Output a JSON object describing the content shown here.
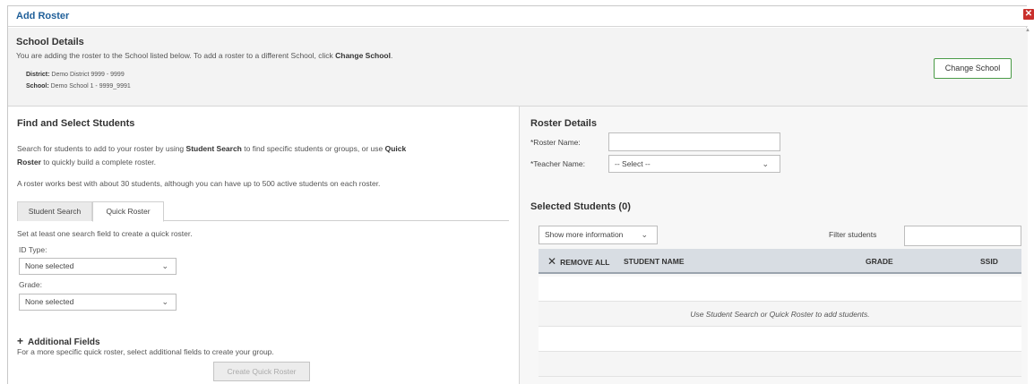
{
  "dialog": {
    "title": "Add Roster",
    "close_icon": "close-icon"
  },
  "school_details": {
    "heading": "School Details",
    "desc_part1": "You are adding the roster to the School listed below. To add a roster to a different School, click ",
    "desc_bold": "Change School",
    "desc_part2": ".",
    "district_label": "District:",
    "district_value": "Demo District 9999 - 9999",
    "school_label": "School:",
    "school_value": "Demo School 1 - 9999_9991",
    "change_button": "Change School"
  },
  "find_students": {
    "heading": "Find and Select Students",
    "p1_a": "Search for students to add to your roster by using ",
    "p1_b": "Student Search",
    "p1_c": " to find specific students or groups, or use ",
    "p1_d": "Quick",
    "p1_e": "Roster",
    "p1_f": " to quickly build a complete roster.",
    "p2": "A roster works best with about 30 students, although you can have up to 500 active students on each roster.",
    "tabs": [
      {
        "label": "Student Search",
        "active": false
      },
      {
        "label": "Quick Roster",
        "active": true
      }
    ],
    "instructions": "Set at least one search field to create a quick roster.",
    "id_type_label": "ID Type:",
    "id_type_value": "None selected",
    "grade_label": "Grade:",
    "grade_value": "None selected",
    "additional_fields_title": "Additional Fields",
    "additional_fields_desc": "For a more specific quick roster, select additional fields to create your group.",
    "create_button": "Create Quick Roster"
  },
  "roster_details": {
    "heading": "Roster Details",
    "roster_name_label": "*Roster Name:",
    "roster_name_value": "",
    "teacher_name_label": "*Teacher Name:",
    "teacher_name_value": "-- Select --"
  },
  "selected_students": {
    "heading": "Selected Students (0)",
    "show_more_button": "Show more information",
    "filter_label": "Filter students",
    "filter_value": "",
    "columns": {
      "remove_all": "REMOVE ALL",
      "student_name": "STUDENT NAME",
      "grade": "GRADE",
      "ssid": "SSID"
    },
    "empty_message": "Use Student Search or Quick Roster to add students."
  },
  "colors": {
    "title_blue": "#1f5f99",
    "close_red": "#c9302c",
    "change_button_border": "#4a9b47"
  }
}
